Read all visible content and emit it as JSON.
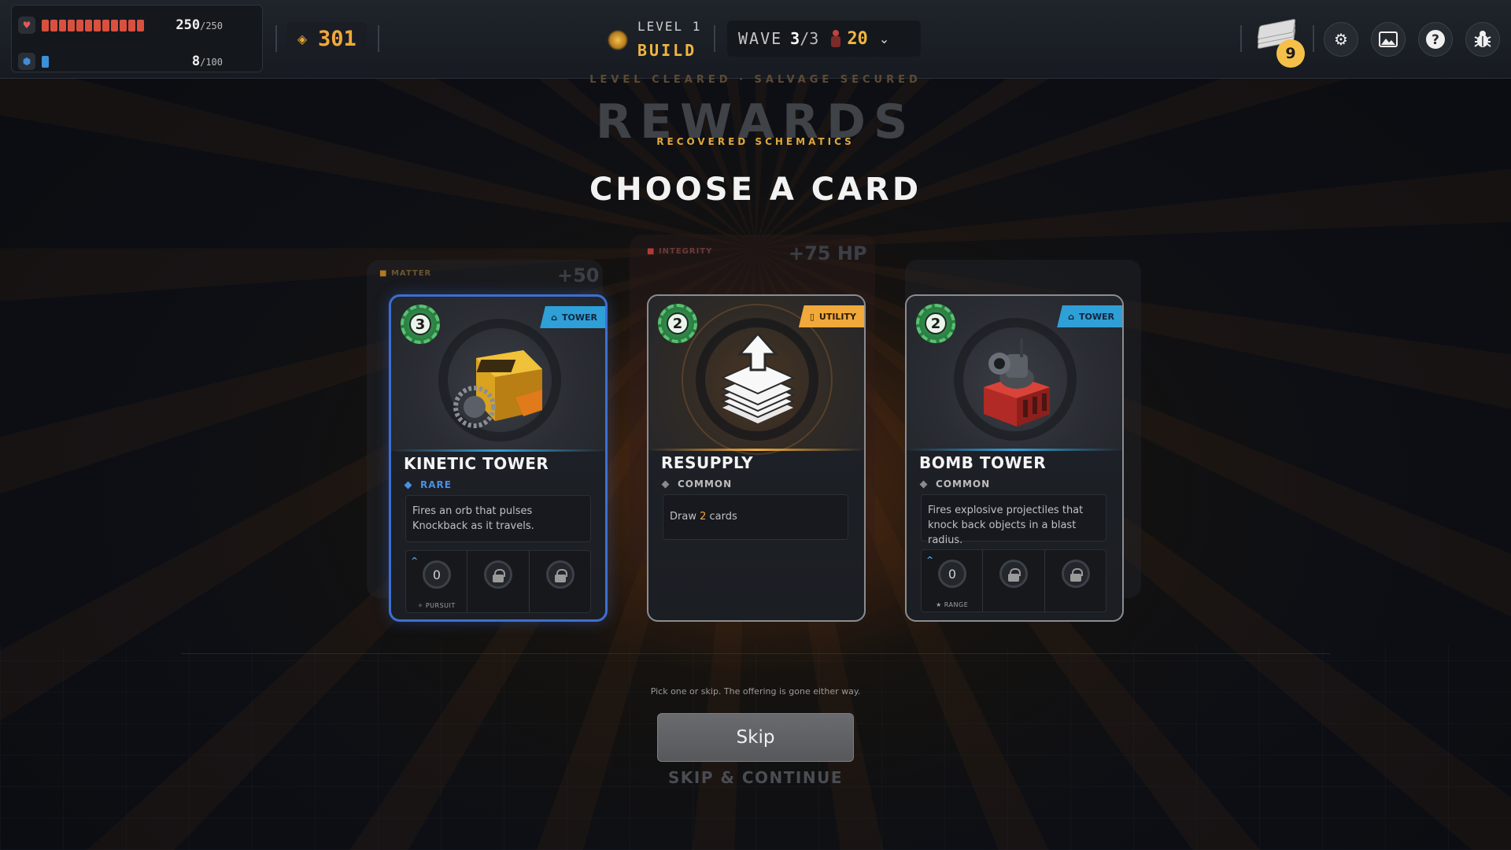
{
  "hud": {
    "health": {
      "current": "250",
      "max": "/250",
      "fraction": 1.0,
      "icon": "heart-icon",
      "color": "#d9503f"
    },
    "shield": {
      "current": "8",
      "max": "/100",
      "fraction": 0.08,
      "icon": "shield-icon",
      "color": "#3c8fd8"
    },
    "matter": {
      "value": "301",
      "icon": "matter-icon"
    },
    "level": {
      "label": "LEVEL 1",
      "phase": "BUILD"
    },
    "wave": {
      "label": "WAVE",
      "current": "3",
      "total": "/3",
      "enemies": "20"
    },
    "deck_count": "9",
    "buttons": [
      "settings-icon",
      "gallery-icon",
      "help-icon",
      "bug-icon"
    ]
  },
  "rewards": {
    "kicker": "LEVEL CLEARED · SALVAGE SECURED",
    "title": "REWARDS",
    "subtitle": "RECOVERED SCHEMATICS",
    "heading": "CHOOSE A CARD"
  },
  "ghost_stats": {
    "matter_label": "MATTER",
    "matter_value": "+50",
    "integrity_label": "INTEGRITY",
    "integrity_value": "+75 HP"
  },
  "cards": [
    {
      "name": "KINETIC TOWER",
      "cost": "3",
      "type": "TOWER",
      "rarity": "RARE",
      "rarity_color": "#4a8fe6",
      "description": "Fires an orb that pulses Knockback as it travels.",
      "slot_value": "0",
      "slot_label": "PURSUIT",
      "selected": true
    },
    {
      "name": "RESUPPLY",
      "cost": "2",
      "type": "UTILITY",
      "rarity": "COMMON",
      "rarity_color": "#bdbdbd",
      "description_prefix": "Draw ",
      "description_value": "2",
      "description_suffix": " cards",
      "selected": false
    },
    {
      "name": "BOMB TOWER",
      "cost": "2",
      "type": "TOWER",
      "rarity": "COMMON",
      "rarity_color": "#bdbdbd",
      "description": "Fires explosive projectiles that knock back objects in a blast radius.",
      "slot_value": "0",
      "slot_label": "RANGE",
      "selected": false
    }
  ],
  "footer": {
    "hint": "Pick one or skip. The offering is gone either way.",
    "skip": "Skip",
    "skip_continue": "SKIP & CONTINUE"
  }
}
